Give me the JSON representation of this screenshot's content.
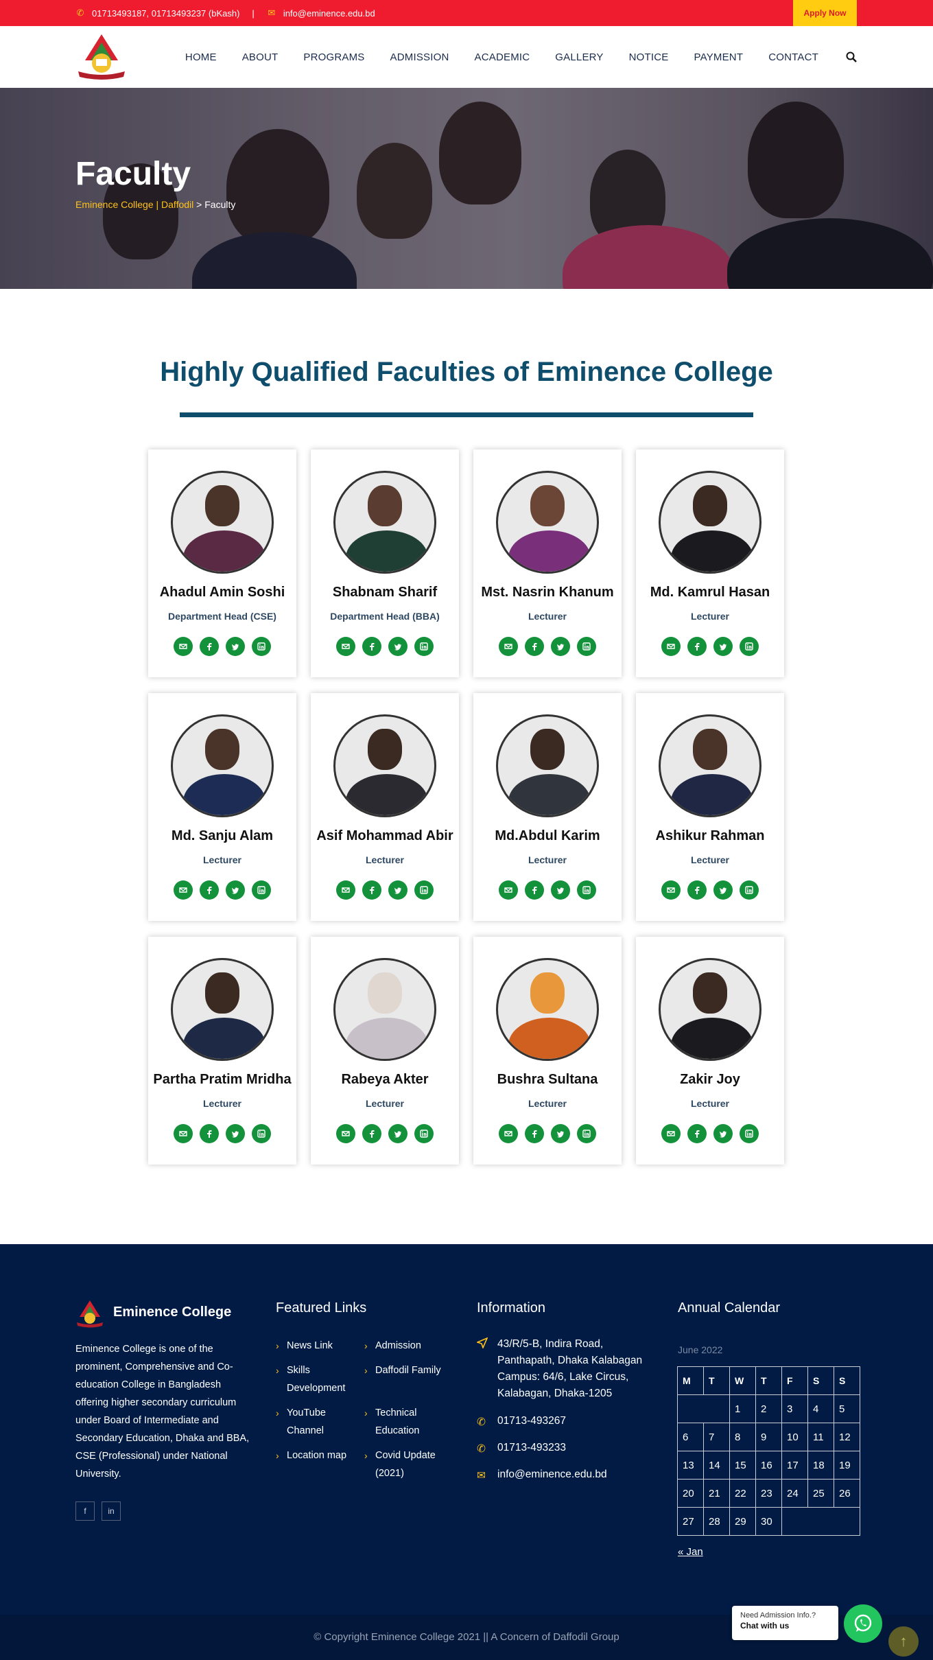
{
  "topbar": {
    "phone": "01713493187, 01713493237 (bKash)",
    "divider": "|",
    "email": "info@eminence.edu.bd",
    "apply_label": "Apply Now"
  },
  "nav": {
    "items": [
      "HOME",
      "ABOUT",
      "PROGRAMS",
      "ADMISSION",
      "ACADEMIC",
      "GALLERY",
      "NOTICE",
      "PAYMENT",
      "CONTACT"
    ]
  },
  "hero": {
    "title": "Faculty",
    "crumb_home": "Eminence College | Daffodil",
    "crumb_sep": " > ",
    "crumb_current": "Faculty"
  },
  "section": {
    "title": "Highly Qualified Faculties of Eminence College"
  },
  "faculty": [
    {
      "name": "Ahadul Amin Soshi",
      "role": "Department Head (CSE)"
    },
    {
      "name": "Shabnam Sharif",
      "role": "Department Head (BBA)"
    },
    {
      "name": "Mst. Nasrin Khanum",
      "role": "Lecturer"
    },
    {
      "name": "Md. Kamrul Hasan",
      "role": "Lecturer"
    },
    {
      "name": "Md. Sanju Alam",
      "role": "Lecturer"
    },
    {
      "name": "Asif Mohammad Abir",
      "role": "Lecturer"
    },
    {
      "name": "Md.Abdul Karim",
      "role": "Lecturer"
    },
    {
      "name": "Ashikur Rahman",
      "role": "Lecturer"
    },
    {
      "name": "Partha Pratim Mridha",
      "role": "Lecturer"
    },
    {
      "name": "Rabeya Akter",
      "role": "Lecturer"
    },
    {
      "name": "Bushra Sultana",
      "role": "Lecturer"
    },
    {
      "name": "Zakir Joy",
      "role": "Lecturer"
    }
  ],
  "footer": {
    "brand": "Eminence College",
    "about": "Eminence College is one of the prominent, Comprehensive and Co-education College in Bangladesh offering higher secondary curriculum under Board of Intermediate and Secondary Education, Dhaka and BBA, CSE (Professional) under National University.",
    "links_title": "Featured Links",
    "links_col1": [
      "News Link",
      "Skills Development",
      "YouTube Channel",
      "Location map"
    ],
    "links_col2": [
      "Admission",
      "Daffodil Family",
      "Technical Education",
      "Covid Update (2021)"
    ],
    "info_title": "Information",
    "address": "43/R/5-B, Indira Road, Panthapath, Dhaka Kalabagan Campus: 64/6, Lake Circus, Kalabagan, Dhaka-1205",
    "phone1": "01713-493267",
    "phone2": "01713-493233",
    "email": "info@eminence.edu.bd",
    "calendar_title": "Annual Calendar",
    "calendar_month": "June 2022",
    "calendar_days": [
      "M",
      "T",
      "W",
      "T",
      "F",
      "S",
      "S"
    ],
    "calendar_prev": "« Jan",
    "copyright": "© Copyright Eminence College 2021 || A Concern of Daffodil Group"
  },
  "whatsapp": {
    "line1": "Need Admission Info.?",
    "line2": "Chat with us"
  },
  "colors": {
    "topbar": "#ee1c2e",
    "accent_yellow": "#ffcc12",
    "title_blue": "#0e4d6b",
    "social_green": "#13913b",
    "footer_bg": "#011b44"
  }
}
